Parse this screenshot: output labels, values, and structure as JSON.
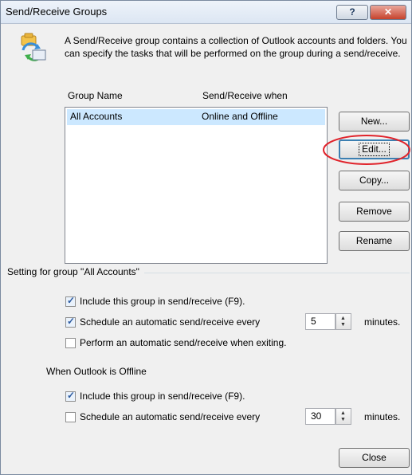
{
  "window": {
    "title": "Send/Receive Groups",
    "help_label": "?",
    "close_label": "✕"
  },
  "info": {
    "text": "A Send/Receive group contains a collection of Outlook accounts and folders. You can specify the tasks that will be performed on the group during a send/receive."
  },
  "list": {
    "columns": [
      "Group Name",
      "Send/Receive when"
    ],
    "rows": [
      {
        "name": "All Accounts",
        "when": "Online and Offline"
      }
    ]
  },
  "buttons": {
    "new": "New...",
    "edit": "Edit...",
    "copy": "Copy...",
    "remove": "Remove",
    "rename": "Rename",
    "close": "Close"
  },
  "group": {
    "label": "Setting for group \"All Accounts\""
  },
  "online": {
    "include": {
      "label": "Include this group in send/receive (F9).",
      "checked": true
    },
    "schedule": {
      "label": "Schedule an automatic send/receive every",
      "checked": true,
      "value": "5",
      "unit": "minutes."
    },
    "exit": {
      "label": "Perform an automatic send/receive when exiting.",
      "checked": false
    }
  },
  "offline": {
    "heading": "When Outlook is Offline",
    "include": {
      "label": "Include this group in send/receive (F9).",
      "checked": true
    },
    "schedule": {
      "label": "Schedule an automatic send/receive every",
      "checked": false,
      "value": "30",
      "unit": "minutes."
    }
  }
}
